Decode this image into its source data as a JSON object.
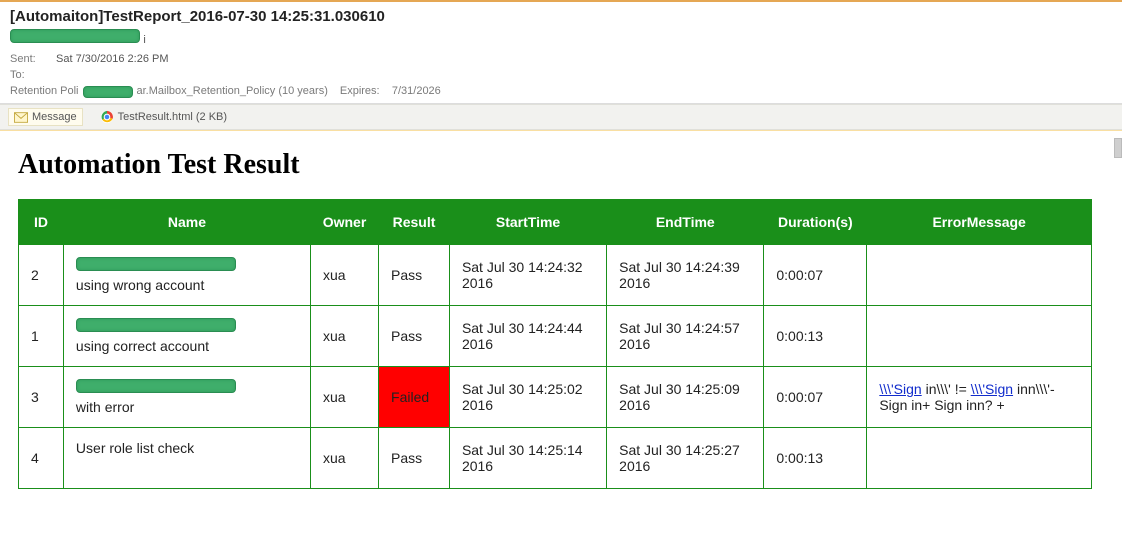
{
  "email": {
    "subject": "[Automaiton]TestReport_2016-07-30 14:25:31.030610",
    "sent_label": "Sent:",
    "sent_value": "Sat 7/30/2016 2:26 PM",
    "to_label": "To:",
    "retention_label": "Retention Poli",
    "retention_value": "ar.Mailbox_Retention_Policy (10 years)",
    "expires_label": "Expires:",
    "expires_value": "7/31/2026",
    "from_trail": "i"
  },
  "attachments": {
    "message_label": "Message",
    "file_name": "TestResult.html (2 KB)"
  },
  "report": {
    "title": "Automation Test Result",
    "headers": {
      "id": "ID",
      "name": "Name",
      "owner": "Owner",
      "result": "Result",
      "start": "StartTime",
      "end": "EndTime",
      "duration": "Duration(s)",
      "error": "ErrorMessage"
    },
    "rows": [
      {
        "id": "2",
        "name_suffix": "using wrong account",
        "owner": "xua",
        "result": "Pass",
        "start": "Sat Jul 30 14:24:32 2016",
        "end": "Sat Jul 30 14:24:39 2016",
        "duration": "0:00:07",
        "error": "",
        "failed": false
      },
      {
        "id": "1",
        "name_suffix": "using correct account",
        "owner": "xua",
        "result": "Pass",
        "start": "Sat Jul 30 14:24:44 2016",
        "end": "Sat Jul 30 14:24:57 2016",
        "duration": "0:00:13",
        "error": "",
        "failed": false
      },
      {
        "id": "3",
        "name_suffix": "with error",
        "owner": "xua",
        "result": "Failed",
        "start": "Sat Jul 30 14:25:02 2016",
        "end": "Sat Jul 30 14:25:09 2016",
        "duration": "0:00:07",
        "error_link1": "\\\\\\'Sign",
        "error_mid": " in\\\\\\' != ",
        "error_link2": "\\\\\\'Sign",
        "error_tail": " inn\\\\\\'- Sign in+ Sign inn? +",
        "failed": true
      },
      {
        "id": "4",
        "name_suffix": "User role list check",
        "name_no_redact": true,
        "owner": "xua",
        "result": "Pass",
        "start": "Sat Jul 30 14:25:14 2016",
        "end": "Sat Jul 30 14:25:27 2016",
        "duration": "0:00:13",
        "error": "",
        "failed": false
      }
    ]
  }
}
